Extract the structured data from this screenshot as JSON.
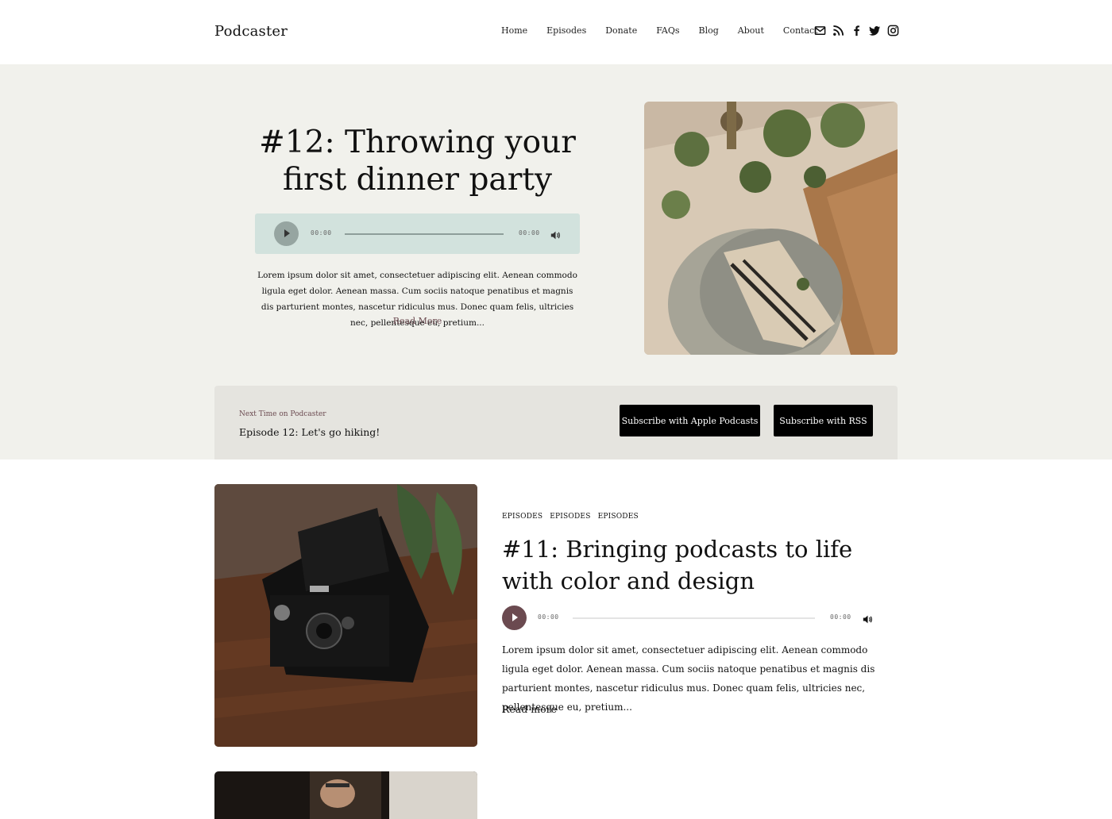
{
  "site": {
    "brand": "Podcaster"
  },
  "nav": {
    "items": [
      "Home",
      "Episodes",
      "Donate",
      "FAQs",
      "Blog",
      "About",
      "Contact"
    ],
    "social_icons": [
      "mail-icon",
      "rss-icon",
      "facebook-icon",
      "twitter-icon",
      "instagram-icon"
    ]
  },
  "hero": {
    "title": "#12: Throwing your first dinner party",
    "player": {
      "current_time": "00:00",
      "duration": "00:00"
    },
    "excerpt": "Lorem ipsum dolor sit amet, consectetuer adipiscing elit. Aenean commodo ligula eget dolor. Aenean massa. Cum sociis natoque penatibus et magnis dis parturient montes, nascetur ridiculus mus. Donec quam felis, ultricies nec, pellentesque eu, pretium...",
    "read_more": "Read More"
  },
  "next_up": {
    "label": "Next Time on Podcaster",
    "title": "Episode 12: Let's go hiking!",
    "buttons": {
      "apple": "Subscribe with Apple Podcasts",
      "rss": "Subscribe with RSS"
    }
  },
  "episode": {
    "categories": [
      "EPISODES",
      "EPISODES",
      "EPISODES"
    ],
    "title": "#11: Bringing podcasts to life with color and design",
    "player": {
      "current_time": "00:00",
      "duration": "00:00"
    },
    "excerpt": "Lorem ipsum dolor sit amet, consectetuer adipiscing elit. Aenean commodo ligula eget dolor. Aenean massa. Cum sociis natoque penatibus et magnis dis parturient montes, nascetur ridiculus mus. Donec quam felis, ultricies nec, pellentesque eu, pretium...",
    "read_more": "Read more"
  },
  "colors": {
    "hero_bg": "#f1f1ec",
    "player_bg": "#d2e2dd",
    "accent": "#6b4a50",
    "next_bar_bg": "#e5e4df",
    "button_bg": "#000000"
  }
}
